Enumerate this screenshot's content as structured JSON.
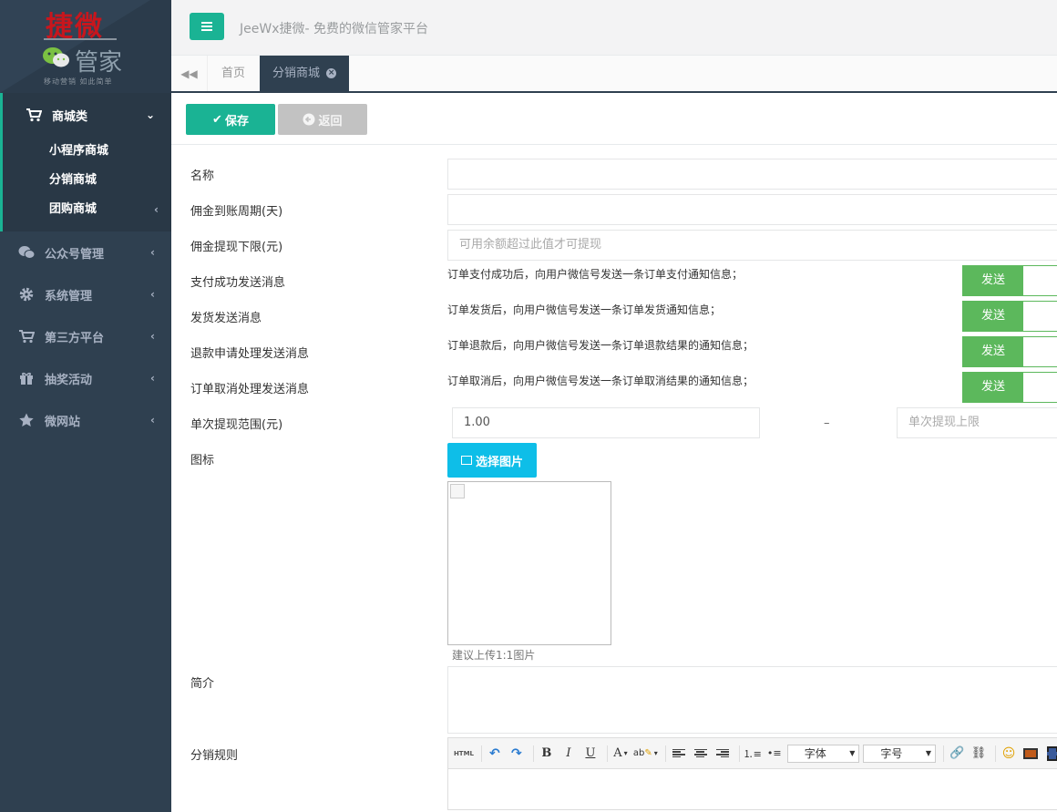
{
  "logo": {
    "line1": "捷微",
    "line2": "管家",
    "slogan": "移动营销 如此简单"
  },
  "header": {
    "site_name": "JeeWx捷微- 免费的微信管家平台"
  },
  "sidebar": {
    "groups": [
      {
        "label": "商城类",
        "icon": "cart-icon",
        "expanded": true,
        "children": [
          {
            "label": "小程序商城"
          },
          {
            "label": "分销商城"
          },
          {
            "label": "团购商城"
          }
        ]
      },
      {
        "label": "公众号管理",
        "icon": "wechat-icon"
      },
      {
        "label": "系统管理",
        "icon": "gear-icon"
      },
      {
        "label": "第三方平台",
        "icon": "cart-icon"
      },
      {
        "label": "抽奖活动",
        "icon": "gift-icon"
      },
      {
        "label": "微网站",
        "icon": "star-icon"
      }
    ]
  },
  "tabs": {
    "home": "首页",
    "current": "分销商城"
  },
  "toolbar": {
    "save_label": "保存",
    "back_label": "返回"
  },
  "form": {
    "name_label": "名称",
    "period_label": "佣金到账周期(天)",
    "min_withdraw_label": "佣金提现下限(元)",
    "min_withdraw_placeholder": "可用余额超过此值才可提现",
    "notify": [
      {
        "label": "支付成功发送消息",
        "desc": "订单支付成功后，向用户微信号发送一条订单支付通知信息；",
        "toggle": "发送"
      },
      {
        "label": "发货发送消息",
        "desc": "订单发货后，向用户微信号发送一条订单发货通知信息；",
        "toggle": "发送"
      },
      {
        "label": "退款申请处理发送消息",
        "desc": "订单退款后，向用户微信号发送一条订单退款结果的通知信息；",
        "toggle": "发送"
      },
      {
        "label": "订单取消处理发送消息",
        "desc": "订单取消后，向用户微信号发送一条订单取消结果的通知信息；",
        "toggle": "发送"
      }
    ],
    "range_label": "单次提现范围(元)",
    "range_min_value": "1.00",
    "range_dash": "–",
    "range_max_placeholder": "单次提现上限",
    "icon_label": "图标",
    "pick_image_label": "选择图片",
    "image_hint": "建议上传1:1图片",
    "intro_label": "简介",
    "rules_label": "分销规则"
  },
  "editor": {
    "html_btn": "HTML",
    "font_select": "字体",
    "size_select": "字号"
  },
  "colors": {
    "sidebar_bg": "#2f4050",
    "accent": "#1ab394",
    "send_green": "#5cb85c",
    "pick_blue": "#0ebee8"
  }
}
